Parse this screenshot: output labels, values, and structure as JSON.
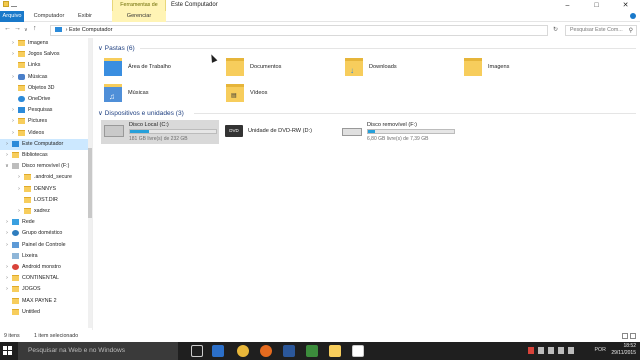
{
  "window": {
    "context_tools": "Ferramentas de Unidade",
    "title": "Este Computador"
  },
  "ribbon": {
    "tabs": [
      "Arquivo",
      "Computador",
      "Exibir",
      "Gerenciar"
    ]
  },
  "address": {
    "path": "Este Computador",
    "search_placeholder": "Pesquisar Este Com..."
  },
  "nav": {
    "items": [
      {
        "label": "Imagens",
        "icon": "folder-icon"
      },
      {
        "label": "Jogos Salvos",
        "icon": "folder-icon"
      },
      {
        "label": "Links",
        "icon": "folder-icon"
      },
      {
        "label": "Músicas",
        "icon": "music-icon"
      },
      {
        "label": "Objetos 3D",
        "icon": "folder-icon"
      },
      {
        "label": "OneDrive",
        "icon": "cloud-icon"
      },
      {
        "label": "Pesquisas",
        "icon": "search-icon"
      },
      {
        "label": "Pictures",
        "icon": "folder-icon"
      },
      {
        "label": "Videos",
        "icon": "folder-icon"
      },
      {
        "label": "Este Computador",
        "icon": "computer-icon"
      },
      {
        "label": "Bibliotecas",
        "icon": "library-icon"
      },
      {
        "label": "Disco removível (F:)",
        "icon": "drive-icon"
      },
      {
        "label": ".android_secure",
        "icon": "folder-icon"
      },
      {
        "label": "DENNYS",
        "icon": "folder-icon"
      },
      {
        "label": "LOST.DIR",
        "icon": "folder-icon"
      },
      {
        "label": "xadrez",
        "icon": "folder-icon"
      },
      {
        "label": "Rede",
        "icon": "network-icon"
      },
      {
        "label": "Grupo doméstico",
        "icon": "homegroup-icon"
      },
      {
        "label": "Painel de Controle",
        "icon": "control-panel-icon"
      },
      {
        "label": "Lixeira",
        "icon": "recycle-bin-icon"
      },
      {
        "label": "Android monstro",
        "icon": "android-icon"
      },
      {
        "label": "CONTINENTAL",
        "icon": "folder-icon"
      },
      {
        "label": "JOGOS",
        "icon": "folder-icon"
      },
      {
        "label": "MAX PAYNE 2",
        "icon": "folder-icon"
      },
      {
        "label": "Untitled",
        "icon": "folder-icon"
      }
    ]
  },
  "folders_group": {
    "title": "Pastas (6)",
    "items": [
      {
        "label": "Área de Trabalho",
        "icon": "desktop-folder-icon"
      },
      {
        "label": "Documentos",
        "icon": "documents-folder-icon"
      },
      {
        "label": "Downloads",
        "icon": "downloads-folder-icon"
      },
      {
        "label": "Imagens",
        "icon": "pictures-folder-icon"
      },
      {
        "label": "Músicas",
        "icon": "music-folder-icon"
      },
      {
        "label": "Vídeos",
        "icon": "videos-folder-icon"
      }
    ]
  },
  "drives_group": {
    "title": "Dispositivos e unidades (3)",
    "items": [
      {
        "label": "Disco Local (C:)",
        "free": "181 GB livre(s) de 232 GB",
        "used_fraction": 0.22,
        "icon": "windows-drive-icon"
      },
      {
        "label": "Unidade de DVD-RW (D:)",
        "free": "",
        "icon": "dvd-drive-icon"
      },
      {
        "label": "Disco removível (F:)",
        "free": "6,80 GB livre(s) de 7,39 GB",
        "used_fraction": 0.08,
        "icon": "removable-drive-icon"
      }
    ]
  },
  "status": {
    "count": "9 itens",
    "selection": "1 item selecionado"
  },
  "taskbar": {
    "search_text": "Pesquisar na Web e no Windows",
    "lang": "POR",
    "time": "18:52",
    "date": "29/11/2015"
  }
}
